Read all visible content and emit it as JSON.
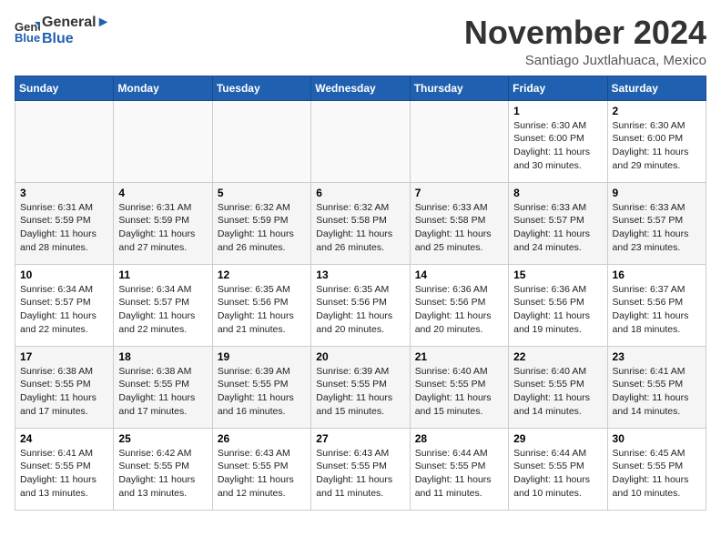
{
  "header": {
    "logo_line1": "General",
    "logo_line2": "Blue",
    "month": "November 2024",
    "location": "Santiago Juxtlahuaca, Mexico"
  },
  "weekdays": [
    "Sunday",
    "Monday",
    "Tuesday",
    "Wednesday",
    "Thursday",
    "Friday",
    "Saturday"
  ],
  "weeks": [
    [
      {
        "day": "",
        "info": ""
      },
      {
        "day": "",
        "info": ""
      },
      {
        "day": "",
        "info": ""
      },
      {
        "day": "",
        "info": ""
      },
      {
        "day": "",
        "info": ""
      },
      {
        "day": "1",
        "info": "Sunrise: 6:30 AM\nSunset: 6:00 PM\nDaylight: 11 hours\nand 30 minutes."
      },
      {
        "day": "2",
        "info": "Sunrise: 6:30 AM\nSunset: 6:00 PM\nDaylight: 11 hours\nand 29 minutes."
      }
    ],
    [
      {
        "day": "3",
        "info": "Sunrise: 6:31 AM\nSunset: 5:59 PM\nDaylight: 11 hours\nand 28 minutes."
      },
      {
        "day": "4",
        "info": "Sunrise: 6:31 AM\nSunset: 5:59 PM\nDaylight: 11 hours\nand 27 minutes."
      },
      {
        "day": "5",
        "info": "Sunrise: 6:32 AM\nSunset: 5:59 PM\nDaylight: 11 hours\nand 26 minutes."
      },
      {
        "day": "6",
        "info": "Sunrise: 6:32 AM\nSunset: 5:58 PM\nDaylight: 11 hours\nand 26 minutes."
      },
      {
        "day": "7",
        "info": "Sunrise: 6:33 AM\nSunset: 5:58 PM\nDaylight: 11 hours\nand 25 minutes."
      },
      {
        "day": "8",
        "info": "Sunrise: 6:33 AM\nSunset: 5:57 PM\nDaylight: 11 hours\nand 24 minutes."
      },
      {
        "day": "9",
        "info": "Sunrise: 6:33 AM\nSunset: 5:57 PM\nDaylight: 11 hours\nand 23 minutes."
      }
    ],
    [
      {
        "day": "10",
        "info": "Sunrise: 6:34 AM\nSunset: 5:57 PM\nDaylight: 11 hours\nand 22 minutes."
      },
      {
        "day": "11",
        "info": "Sunrise: 6:34 AM\nSunset: 5:57 PM\nDaylight: 11 hours\nand 22 minutes."
      },
      {
        "day": "12",
        "info": "Sunrise: 6:35 AM\nSunset: 5:56 PM\nDaylight: 11 hours\nand 21 minutes."
      },
      {
        "day": "13",
        "info": "Sunrise: 6:35 AM\nSunset: 5:56 PM\nDaylight: 11 hours\nand 20 minutes."
      },
      {
        "day": "14",
        "info": "Sunrise: 6:36 AM\nSunset: 5:56 PM\nDaylight: 11 hours\nand 20 minutes."
      },
      {
        "day": "15",
        "info": "Sunrise: 6:36 AM\nSunset: 5:56 PM\nDaylight: 11 hours\nand 19 minutes."
      },
      {
        "day": "16",
        "info": "Sunrise: 6:37 AM\nSunset: 5:56 PM\nDaylight: 11 hours\nand 18 minutes."
      }
    ],
    [
      {
        "day": "17",
        "info": "Sunrise: 6:38 AM\nSunset: 5:55 PM\nDaylight: 11 hours\nand 17 minutes."
      },
      {
        "day": "18",
        "info": "Sunrise: 6:38 AM\nSunset: 5:55 PM\nDaylight: 11 hours\nand 17 minutes."
      },
      {
        "day": "19",
        "info": "Sunrise: 6:39 AM\nSunset: 5:55 PM\nDaylight: 11 hours\nand 16 minutes."
      },
      {
        "day": "20",
        "info": "Sunrise: 6:39 AM\nSunset: 5:55 PM\nDaylight: 11 hours\nand 15 minutes."
      },
      {
        "day": "21",
        "info": "Sunrise: 6:40 AM\nSunset: 5:55 PM\nDaylight: 11 hours\nand 15 minutes."
      },
      {
        "day": "22",
        "info": "Sunrise: 6:40 AM\nSunset: 5:55 PM\nDaylight: 11 hours\nand 14 minutes."
      },
      {
        "day": "23",
        "info": "Sunrise: 6:41 AM\nSunset: 5:55 PM\nDaylight: 11 hours\nand 14 minutes."
      }
    ],
    [
      {
        "day": "24",
        "info": "Sunrise: 6:41 AM\nSunset: 5:55 PM\nDaylight: 11 hours\nand 13 minutes."
      },
      {
        "day": "25",
        "info": "Sunrise: 6:42 AM\nSunset: 5:55 PM\nDaylight: 11 hours\nand 13 minutes."
      },
      {
        "day": "26",
        "info": "Sunrise: 6:43 AM\nSunset: 5:55 PM\nDaylight: 11 hours\nand 12 minutes."
      },
      {
        "day": "27",
        "info": "Sunrise: 6:43 AM\nSunset: 5:55 PM\nDaylight: 11 hours\nand 11 minutes."
      },
      {
        "day": "28",
        "info": "Sunrise: 6:44 AM\nSunset: 5:55 PM\nDaylight: 11 hours\nand 11 minutes."
      },
      {
        "day": "29",
        "info": "Sunrise: 6:44 AM\nSunset: 5:55 PM\nDaylight: 11 hours\nand 10 minutes."
      },
      {
        "day": "30",
        "info": "Sunrise: 6:45 AM\nSunset: 5:55 PM\nDaylight: 11 hours\nand 10 minutes."
      }
    ]
  ]
}
